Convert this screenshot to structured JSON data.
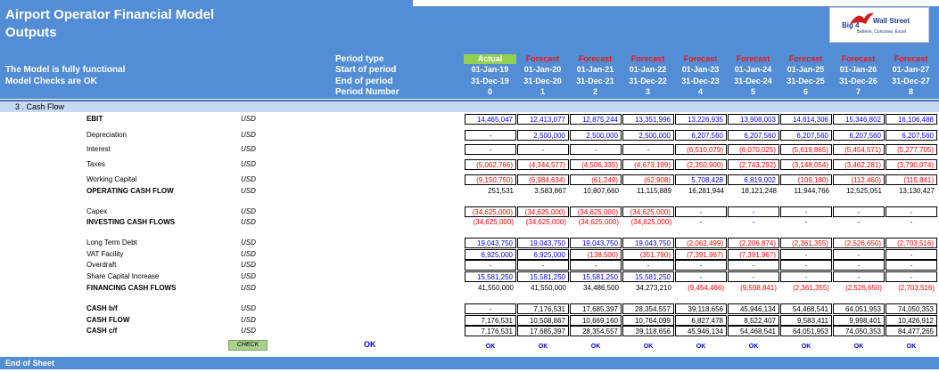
{
  "header": {
    "title": "Airport Operator Financial Model",
    "subtitle": "Outputs",
    "status_line1": "The Model is fully functional",
    "status_line2": "Model Checks are OK",
    "row_labels": [
      "Period type",
      "Start of period",
      "End of period",
      "Period Number"
    ]
  },
  "logo": {
    "text_left": "Big 4",
    "text_right": "Wall Street",
    "tagline": "Believe, Conceive, Excel",
    "colors": {
      "bird": "#cc1f1f",
      "text": "#1f3b8a"
    }
  },
  "periods": [
    {
      "type": "Actual",
      "start": "01-Jan-19",
      "end": "31-Dec-19",
      "number": "0"
    },
    {
      "type": "Forecast",
      "start": "01-Jan-20",
      "end": "31-Dec-20",
      "number": "1"
    },
    {
      "type": "Forecast",
      "start": "01-Jan-21",
      "end": "31-Dec-21",
      "number": "2"
    },
    {
      "type": "Forecast",
      "start": "01-Jan-22",
      "end": "31-Dec-22",
      "number": "3"
    },
    {
      "type": "Forecast",
      "start": "01-Jan-23",
      "end": "31-Dec-23",
      "number": "4"
    },
    {
      "type": "Forecast",
      "start": "01-Jan-24",
      "end": "31-Dec-24",
      "number": "5"
    },
    {
      "type": "Forecast",
      "start": "01-Jan-25",
      "end": "31-Dec-25",
      "number": "6"
    },
    {
      "type": "Forecast",
      "start": "01-Jan-26",
      "end": "31-Dec-26",
      "number": "7"
    },
    {
      "type": "Forecast",
      "start": "01-Jan-27",
      "end": "31-Dec-27",
      "number": "8"
    }
  ],
  "section": {
    "label": "3 .  Cash Flow"
  },
  "rows": [
    {
      "label": "EBIT",
      "unit": "USD",
      "bold": true,
      "boxed": true,
      "values": [
        "14,465,047",
        "12,413,077",
        "12,875,244",
        "13,351,996",
        "13,226,935",
        "13,908,003",
        "14,614,306",
        "15,346,802",
        "16,106,488"
      ],
      "colors": [
        "blue",
        "blue",
        "blue",
        "blue",
        "blue",
        "blue",
        "blue",
        "blue",
        "blue"
      ]
    },
    {
      "label": "Depreciation",
      "unit": "USD",
      "bold": false,
      "boxed": true,
      "values": [
        "-",
        "2,500,000",
        "2,500,000",
        "2,500,000",
        "6,207,560",
        "6,207,560",
        "6,207,560",
        "6,207,560",
        "6,207,560"
      ],
      "colors": [
        "blue",
        "blue",
        "blue",
        "blue",
        "blue",
        "blue",
        "blue",
        "blue",
        "blue"
      ]
    },
    {
      "label": "Interest",
      "unit": "USD",
      "bold": false,
      "boxed": true,
      "values": [
        "-",
        "-",
        "-",
        "-",
        "(6,510,079)",
        "(6,070,025)",
        "(5,619,865)",
        "(5,454,571)",
        "(5,277,705)"
      ],
      "colors": [
        "blue",
        "blue",
        "blue",
        "blue",
        "red",
        "red",
        "red",
        "red",
        "red"
      ]
    },
    {
      "label": "Taxes",
      "unit": "USD",
      "bold": false,
      "boxed": true,
      "values": [
        "(5,062,766)",
        "(4,344,577)",
        "(4,506,335)",
        "(4,673,199)",
        "(2,350,900)",
        "(2,743,292)",
        "(3,148,054)",
        "(3,462,281)",
        "(3,790,074)"
      ],
      "colors": [
        "red",
        "red",
        "red",
        "red",
        "red",
        "red",
        "red",
        "red",
        "red"
      ]
    },
    {
      "label": "Working Capital",
      "unit": "USD",
      "bold": false,
      "boxed": true,
      "values": [
        "(9,150,750)",
        "(6,984,634)",
        "(61,249)",
        "(62,908)",
        "5,708,428",
        "6,819,002",
        "(109,180)",
        "(112,460)",
        "(115,841)"
      ],
      "colors": [
        "red",
        "red",
        "red",
        "red",
        "blue",
        "blue",
        "red",
        "red",
        "red"
      ]
    },
    {
      "label": "OPERATING CASH FLOW",
      "unit": "USD",
      "bold": true,
      "boxed": false,
      "values": [
        "251,531",
        "3,583,867",
        "10,807,660",
        "11,115,889",
        "16,281,944",
        "18,121,248",
        "11,944,766",
        "12,525,051",
        "13,130,427"
      ],
      "colors": [
        "blk",
        "blk",
        "blk",
        "blk",
        "blk",
        "blk",
        "blk",
        "blk",
        "blk"
      ]
    },
    {
      "label": "Capex",
      "unit": "USD",
      "bold": false,
      "boxed": true,
      "values": [
        "(34,625,000)",
        "(34,625,000)",
        "(34,625,000)",
        "(34,625,000)",
        "-",
        "-",
        "-",
        "-",
        "-"
      ],
      "colors": [
        "red",
        "red",
        "red",
        "red",
        "blue",
        "blue",
        "blue",
        "blue",
        "blue"
      ]
    },
    {
      "label": "INVESTING CASH FLOWS",
      "unit": "USD",
      "bold": true,
      "boxed": false,
      "values": [
        "(34,625,000)",
        "(34,625,000)",
        "(34,625,000)",
        "(34,625,000)",
        "-",
        "-",
        "-",
        "-",
        "-"
      ],
      "colors": [
        "red",
        "red",
        "red",
        "red",
        "blk",
        "blk",
        "blk",
        "blk",
        "blk"
      ]
    },
    {
      "label": "Long Term Debt",
      "unit": "USD",
      "bold": false,
      "boxed": true,
      "values": [
        "19,043,750",
        "19,043,750",
        "19,043,750",
        "19,043,750",
        "(2,062,499)",
        "(2,206,874)",
        "(2,361,355)",
        "(2,526,650)",
        "(2,703,516)"
      ],
      "colors": [
        "blue",
        "blue",
        "blue",
        "blue",
        "red",
        "red",
        "red",
        "red",
        "red"
      ]
    },
    {
      "label": "VAT Facility",
      "unit": "USD",
      "bold": false,
      "boxed": true,
      "values": [
        "6,925,000",
        "6,925,000",
        "(138,500)",
        "(351,790)",
        "(7,391,967)",
        "(7,391,967)",
        "-",
        "-",
        "-"
      ],
      "colors": [
        "blue",
        "blue",
        "red",
        "red",
        "red",
        "red",
        "blue",
        "blue",
        "blue"
      ]
    },
    {
      "label": "Overdraft",
      "unit": "USD",
      "bold": false,
      "boxed": true,
      "values": [
        "-",
        "-",
        "-",
        "-",
        "-",
        "-",
        "-",
        "-",
        "-"
      ],
      "colors": [
        "blue",
        "blue",
        "blue",
        "blue",
        "blue",
        "blue",
        "blue",
        "blue",
        "blue"
      ]
    },
    {
      "label": "Share Capital Increase",
      "unit": "USD",
      "bold": false,
      "boxed": true,
      "values": [
        "15,581,250",
        "15,581,250",
        "15,581,250",
        "15,581,250",
        "-",
        "-",
        "-",
        "-",
        "-"
      ],
      "colors": [
        "blue",
        "blue",
        "blue",
        "blue",
        "blue",
        "blue",
        "blue",
        "blue",
        "blue"
      ]
    },
    {
      "label": "FINANCING CASH FLOWS",
      "unit": "USD",
      "bold": true,
      "boxed": false,
      "values": [
        "41,550,000",
        "41,550,000",
        "34,486,500",
        "34,273,210",
        "(9,454,466)",
        "(9,598,841)",
        "(2,361,355)",
        "(2,526,650)",
        "(2,703,516)"
      ],
      "colors": [
        "blk",
        "blk",
        "blk",
        "blk",
        "red",
        "red",
        "red",
        "red",
        "red"
      ]
    },
    {
      "label": "CASH b/f",
      "unit": "USD",
      "bold": true,
      "boxed": true,
      "values": [
        "-",
        "7,176,531",
        "17,685,397",
        "28,354,557",
        "39,118,656",
        "45,946,134",
        "54,468,541",
        "64,051,953",
        "74,050,353"
      ],
      "colors": [
        "blk",
        "blk",
        "blk",
        "blk",
        "blk",
        "blk",
        "blk",
        "blk",
        "blk"
      ]
    },
    {
      "label": "CASH FLOW",
      "unit": "USD",
      "bold": true,
      "boxed": true,
      "values": [
        "7,176,531",
        "10,508,867",
        "10,669,160",
        "10,764,099",
        "6,827,478",
        "8,522,407",
        "9,583,411",
        "9,998,401",
        "10,426,912"
      ],
      "colors": [
        "blk",
        "blk",
        "blk",
        "blk",
        "blk",
        "blk",
        "blk",
        "blk",
        "blk"
      ]
    },
    {
      "label": "CASH c/f",
      "unit": "USD",
      "bold": true,
      "boxed": true,
      "values": [
        "7,176,531",
        "17,685,397",
        "28,354,557",
        "39,118,656",
        "45,946,134",
        "54,468,541",
        "64,051,953",
        "74,050,353",
        "84,477,265"
      ],
      "colors": [
        "blk",
        "blk",
        "blk",
        "blk",
        "blk",
        "blk",
        "blk",
        "blk",
        "blk"
      ]
    }
  ],
  "checks": {
    "button_label": "CHECK",
    "overall": "OK",
    "values": [
      "OK",
      "OK",
      "OK",
      "OK",
      "OK",
      "OK",
      "OK",
      "OK",
      "OK"
    ]
  },
  "footer": {
    "label": "End of Sheet"
  },
  "colors": {
    "band": "#538dd5",
    "section": "#c5d9f1",
    "actual": "#92d050",
    "forecast_text": "#e41c1c",
    "blue_value": "#0000ff",
    "red_value": "#ff0000"
  }
}
